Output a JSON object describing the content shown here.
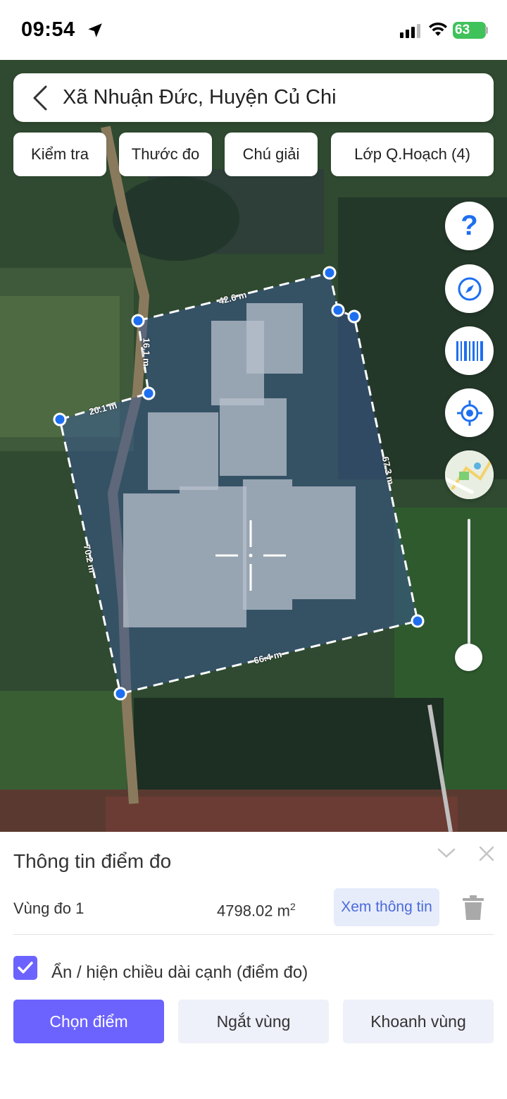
{
  "status": {
    "time": "09:54",
    "battery": "63"
  },
  "header": {
    "title": "Xã Nhuận Đức, Huyện Củ Chi"
  },
  "chips": [
    {
      "label": "Kiểm tra"
    },
    {
      "label": "Thước đo"
    },
    {
      "label": "Chú giải"
    },
    {
      "label": "Lớp Q.Hoạch (4)"
    }
  ],
  "map_tools": {
    "help_label": "?"
  },
  "measurements": {
    "top": "42.6 m",
    "left_upper": "16.1 m",
    "left_step": "20.1 m",
    "right": "67.3 m",
    "left": "70.2 m",
    "bottom": "66.4 m"
  },
  "panel": {
    "title": "Thông tin điểm đo",
    "region_label": "Vùng đo 1",
    "area_value": "4798.02 m",
    "area_unit_exp": "2",
    "info_button": "Xem thông tin",
    "toggle_label": "Ẩn / hiện chiều dài cạnh (điểm đo)",
    "toggle_checked": true,
    "actions": [
      {
        "label": "Chọn điểm",
        "active": true
      },
      {
        "label": "Ngắt vùng",
        "active": false
      },
      {
        "label": "Khoanh vùng",
        "active": false
      }
    ]
  },
  "colors": {
    "accent": "#6c63ff",
    "polygon_point": "#1e6ff0",
    "info_button_text": "#4b6ad9"
  }
}
